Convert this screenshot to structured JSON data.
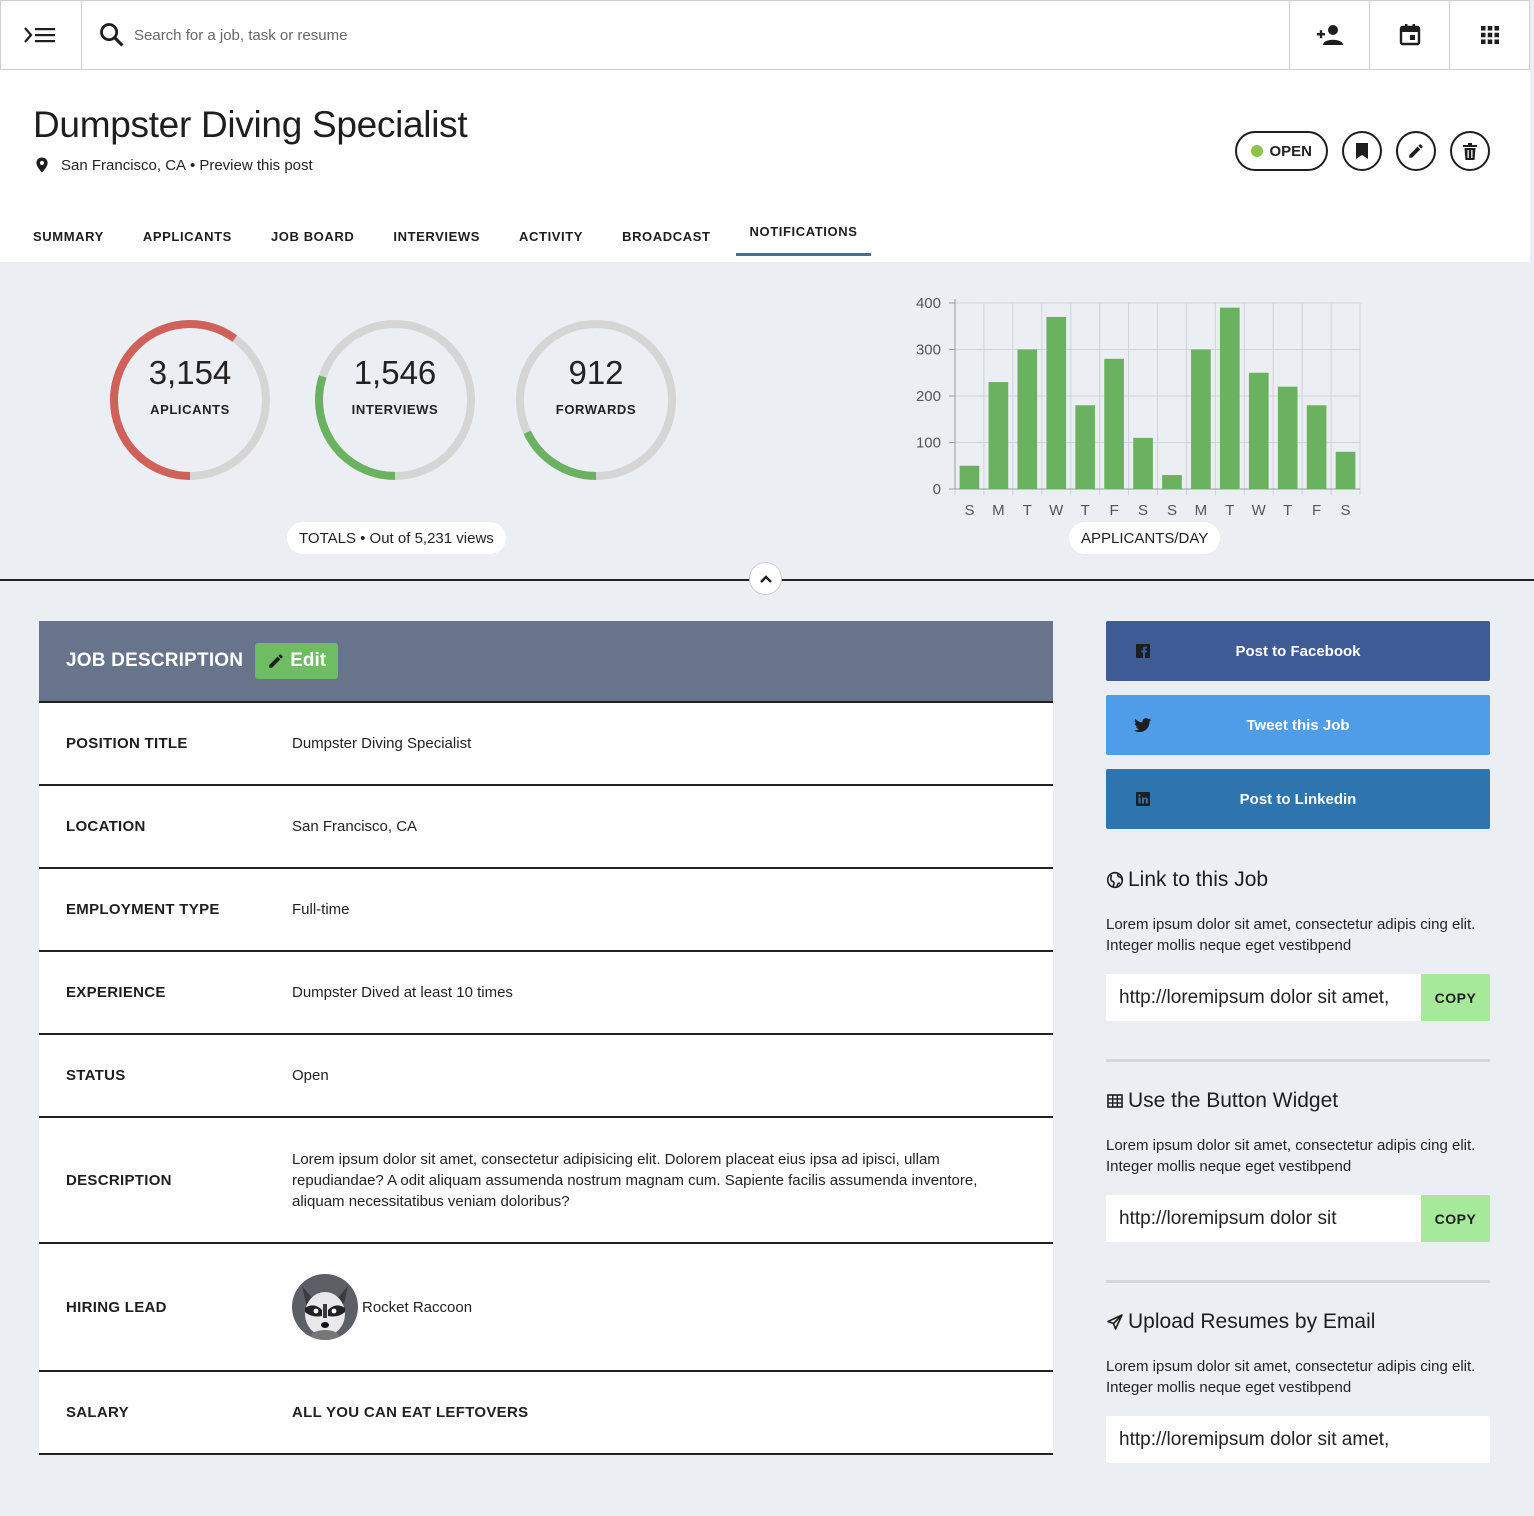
{
  "search": {
    "placeholder": "Search for a job, task or resume"
  },
  "header": {
    "title": "Dumpster Diving Specialist",
    "location": "San Francisco, CA",
    "separator": "•",
    "preview_link": "Preview this post",
    "status": "OPEN",
    "status_color": "#8bc34a"
  },
  "tabs": [
    "SUMMARY",
    "APPLICANTS",
    "JOB BOARD",
    "INTERVIEWS",
    "ACTIVITY",
    "BROADCAST",
    "NOTIFICATIONS"
  ],
  "active_tab": "NOTIFICATIONS",
  "stats": {
    "rings": [
      {
        "value": "3,154",
        "label": "APLICANTS",
        "progress": 0.6,
        "color": "#d0605a"
      },
      {
        "value": "1,546",
        "label": "INTERVIEWS",
        "progress": 0.3,
        "color": "#6ab25f"
      },
      {
        "value": "912",
        "label": "FORWARDS",
        "progress": 0.18,
        "color": "#6ab25f"
      }
    ],
    "totals_label": "TOTALS • Out of 5,231 views"
  },
  "chart_data": {
    "type": "bar",
    "categories": [
      "S",
      "M",
      "T",
      "W",
      "T",
      "F",
      "S",
      "S",
      "M",
      "T",
      "W",
      "T",
      "F",
      "S"
    ],
    "values": [
      50,
      230,
      300,
      370,
      180,
      280,
      110,
      30,
      300,
      390,
      250,
      220,
      180,
      80
    ],
    "xlabel": "APPLICANTS/DAY",
    "ylabel": "",
    "ylim": [
      0,
      400
    ],
    "yticks": [
      "0",
      "100",
      "200",
      "300",
      "400"
    ],
    "grid": true,
    "bar_color": "#6ab25f"
  },
  "job_description": {
    "title": "JOB DESCRIPTION",
    "edit_label": "Edit",
    "rows": [
      {
        "label": "POSITION TITLE",
        "value": "Dumpster Diving Specialist"
      },
      {
        "label": "LOCATION",
        "value": "San Francisco, CA"
      },
      {
        "label": "EMPLOYMENT TYPE",
        "value": "Full-time"
      },
      {
        "label": "EXPERIENCE",
        "value": "Dumpster Dived at least 10 times"
      },
      {
        "label": "STATUS",
        "value": "Open"
      },
      {
        "label": "DESCRIPTION",
        "value": "Lorem ipsum dolor sit amet, consectetur adipisicing elit. Dolorem placeat eius ipsa ad ipisci, ullam repudiandae? A odit aliquam assumenda nostrum magnam cum. Sapiente facilis assumenda inventore, aliquam necessitatibus veniam doloribus?"
      },
      {
        "label": "HIRING LEAD",
        "value": "Rocket Raccoon"
      },
      {
        "label": "SALARY",
        "value": "ALL YOU CAN EAT LEFTOVERS"
      }
    ]
  },
  "social": [
    {
      "label": "Post to Facebook",
      "icon": "facebook-icon",
      "color": "#3f5b96"
    },
    {
      "label": "Tweet this Job",
      "icon": "twitter-icon",
      "color": "#4f9de8"
    },
    {
      "label": "Post to Linkedin",
      "icon": "linkedin-icon",
      "color": "#2e75b0"
    }
  ],
  "sections": [
    {
      "title": "Link to this Job",
      "icon": "globe-icon",
      "text": "Lorem ipsum dolor sit amet, consectetur adipis cing elit. Integer mollis neque eget vestibpend",
      "url": "http://loremipsum dolor sit amet,",
      "copy_label": "COPY"
    },
    {
      "title": "Use the Button Widget",
      "icon": "grid-icon",
      "text": "Lorem ipsum dolor sit amet, consectetur adipis cing elit. Integer mollis neque eget vestibpend",
      "url": "http://loremipsum dolor sit",
      "copy_label": "COPY"
    },
    {
      "title": "Upload Resumes by Email",
      "icon": "send-icon",
      "text": "Lorem ipsum dolor sit amet, consectetur adipis cing elit. Integer mollis neque eget vestibpend",
      "url": "http://loremipsum dolor sit amet,"
    }
  ]
}
